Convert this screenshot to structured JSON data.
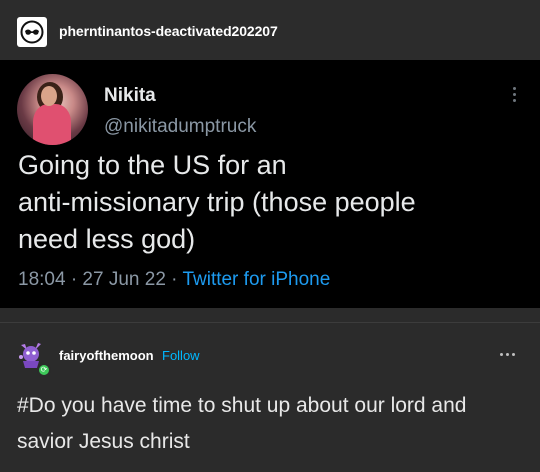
{
  "reblog": {
    "username": "pherntinantos-deactivated202207",
    "avatar_icon": "glasses-logo-icon"
  },
  "tweet": {
    "name": "Nikita",
    "handle": "@nikitadumptruck",
    "text": "Going to the US for an\nanti-missionary trip (those people\nneed less god)",
    "time": "18:04 · 27 Jun 22 · ",
    "source": "Twitter for iPhone",
    "menu_icon": "vertical-ellipsis-icon"
  },
  "post": {
    "username": "fairyofthemoon",
    "follow_label": "Follow",
    "text": "#Do you have time to shut up about our lord and savior Jesus christ",
    "menu_icon": "horizontal-ellipsis-icon",
    "badge_icon": "reblog-icon"
  },
  "colors": {
    "tweet_bg": "#000000",
    "page_bg": "#2b2b2b",
    "link": "#1d9bf0",
    "follow": "#00b8ff"
  }
}
